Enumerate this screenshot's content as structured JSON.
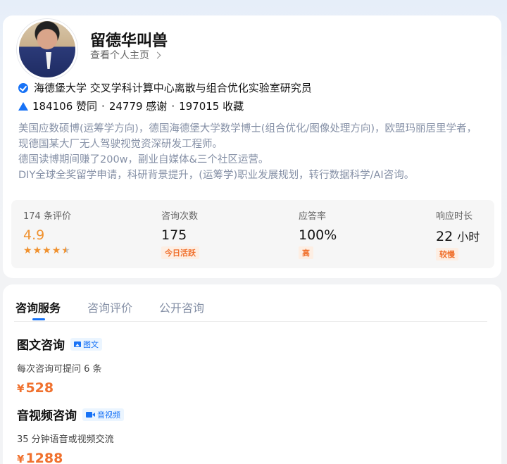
{
  "profile": {
    "name": "留德华叫兽",
    "homepage_link": "查看个人主页",
    "verification": "海德堡大学 交叉学科计算中心离散与组合优化实验室研究员",
    "stats": {
      "upvotes": "184106 赞同",
      "thanks": "24779 感谢",
      "favorites": "197015 收藏",
      "separator": "·"
    },
    "bio": [
      "美国应数硕博(运筹学方向)，德国海德堡大学数学博士(组合优化/图像处理方向)，欧盟玛丽居里学者，",
      "现德国某大厂无人驾驶视觉资深研发工程师。",
      "德国读博期间赚了200w，副业自媒体&三个社区运营。",
      "DIY全球全奖留学申请，科研背景提升，(运筹学)职业发展规划，转行数据科学/AI咨询。"
    ]
  },
  "metrics": {
    "reviews": {
      "label": "174 条评价",
      "value": "4.9",
      "rating": 4.9
    },
    "consultations": {
      "label": "咨询次数",
      "value": "175",
      "badge": "今日活跃"
    },
    "response_rate": {
      "label": "应答率",
      "value": "100%",
      "badge": "高"
    },
    "response_time": {
      "label": "响应时长",
      "value": "22",
      "unit": "小时",
      "badge": "较慢"
    }
  },
  "tabs": [
    {
      "label": "咨询服务",
      "active": true
    },
    {
      "label": "咨询评价",
      "active": false
    },
    {
      "label": "公开咨询",
      "active": false
    }
  ],
  "services": [
    {
      "title": "图文咨询",
      "tag": "图文",
      "desc": "每次咨询可提问 6 条",
      "currency": "¥",
      "price": "528"
    },
    {
      "title": "音视频咨询",
      "tag": "音视频",
      "desc": "35 分钟语音或视频交流",
      "currency": "¥",
      "price": "1288"
    }
  ],
  "colors": {
    "accent_blue": "#1772f6",
    "accent_orange": "#f0912e",
    "price_orange": "#f0712e"
  }
}
